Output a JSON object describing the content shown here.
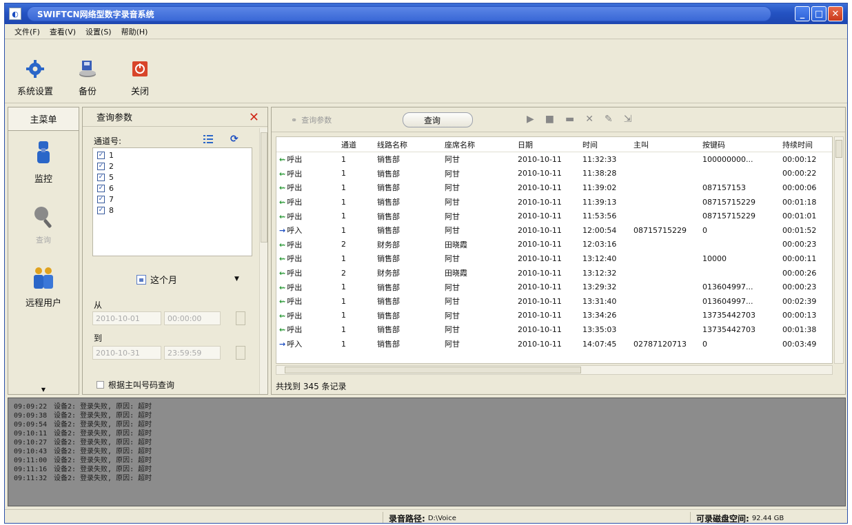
{
  "window": {
    "title": "SWIFTCN网络型数字录音系统"
  },
  "menu": [
    "文件(F)",
    "查看(V)",
    "设置(S)",
    "帮助(H)"
  ],
  "toolbar": [
    {
      "label": "系统设置",
      "icon": "gear-icon"
    },
    {
      "label": "备份",
      "icon": "backup-icon"
    },
    {
      "label": "关闭",
      "icon": "power-icon"
    }
  ],
  "sidebar": {
    "title": "主菜单",
    "items": [
      {
        "label": "监控",
        "icon": "monitor-icon",
        "dim": false
      },
      {
        "label": "查询",
        "icon": "magnifier-icon",
        "dim": true
      },
      {
        "label": "远程用户",
        "icon": "users-icon",
        "dim": false
      }
    ]
  },
  "query_params": {
    "title": "查询参数",
    "channel_label": "通道号:",
    "channels": [
      {
        "id": "1",
        "checked": true
      },
      {
        "id": "2",
        "checked": true
      },
      {
        "id": "5",
        "checked": true
      },
      {
        "id": "6",
        "checked": true
      },
      {
        "id": "7",
        "checked": true
      },
      {
        "id": "8",
        "checked": true
      }
    ],
    "period": "这个月",
    "from_label": "从",
    "from_date": "2010-10-01",
    "from_time": "00:00:00",
    "to_label": "到",
    "to_date": "2010-10-31",
    "to_time": "23:59:59",
    "caller_query": "根据主叫号码查询"
  },
  "records": {
    "query_params_button": "查询参数",
    "search_button": "查询",
    "columns": [
      "",
      "通道",
      "线路名称",
      "座席名称",
      "日期",
      "时间",
      "主叫",
      "按键码",
      "持续时间"
    ],
    "rows": [
      {
        "dir": "out",
        "dir_label": "呼出",
        "ch": "1",
        "line": "销售部",
        "seat": "阿甘",
        "date": "2010-10-11",
        "time": "11:32:33",
        "caller": "",
        "dtmf": "100000000...",
        "dur": "00:00:12"
      },
      {
        "dir": "out",
        "dir_label": "呼出",
        "ch": "1",
        "line": "销售部",
        "seat": "阿甘",
        "date": "2010-10-11",
        "time": "11:38:28",
        "caller": "",
        "dtmf": "",
        "dur": "00:00:22"
      },
      {
        "dir": "out",
        "dir_label": "呼出",
        "ch": "1",
        "line": "销售部",
        "seat": "阿甘",
        "date": "2010-10-11",
        "time": "11:39:02",
        "caller": "",
        "dtmf": "087157153",
        "dur": "00:00:06"
      },
      {
        "dir": "out",
        "dir_label": "呼出",
        "ch": "1",
        "line": "销售部",
        "seat": "阿甘",
        "date": "2010-10-11",
        "time": "11:39:13",
        "caller": "",
        "dtmf": "08715715229",
        "dur": "00:01:18"
      },
      {
        "dir": "out",
        "dir_label": "呼出",
        "ch": "1",
        "line": "销售部",
        "seat": "阿甘",
        "date": "2010-10-11",
        "time": "11:53:56",
        "caller": "",
        "dtmf": "08715715229",
        "dur": "00:01:01"
      },
      {
        "dir": "in",
        "dir_label": "呼入",
        "ch": "1",
        "line": "销售部",
        "seat": "阿甘",
        "date": "2010-10-11",
        "time": "12:00:54",
        "caller": "08715715229",
        "dtmf": "0",
        "dur": "00:01:52"
      },
      {
        "dir": "out",
        "dir_label": "呼出",
        "ch": "2",
        "line": "财务部",
        "seat": "田晓霞",
        "date": "2010-10-11",
        "time": "12:03:16",
        "caller": "",
        "dtmf": "",
        "dur": "00:00:23"
      },
      {
        "dir": "out",
        "dir_label": "呼出",
        "ch": "1",
        "line": "销售部",
        "seat": "阿甘",
        "date": "2010-10-11",
        "time": "13:12:40",
        "caller": "",
        "dtmf": "10000",
        "dur": "00:00:11"
      },
      {
        "dir": "out",
        "dir_label": "呼出",
        "ch": "2",
        "line": "财务部",
        "seat": "田晓霞",
        "date": "2010-10-11",
        "time": "13:12:32",
        "caller": "",
        "dtmf": "",
        "dur": "00:00:26"
      },
      {
        "dir": "out",
        "dir_label": "呼出",
        "ch": "1",
        "line": "销售部",
        "seat": "阿甘",
        "date": "2010-10-11",
        "time": "13:29:32",
        "caller": "",
        "dtmf": "013604997...",
        "dur": "00:00:23"
      },
      {
        "dir": "out",
        "dir_label": "呼出",
        "ch": "1",
        "line": "销售部",
        "seat": "阿甘",
        "date": "2010-10-11",
        "time": "13:31:40",
        "caller": "",
        "dtmf": "013604997...",
        "dur": "00:02:39"
      },
      {
        "dir": "out",
        "dir_label": "呼出",
        "ch": "1",
        "line": "销售部",
        "seat": "阿甘",
        "date": "2010-10-11",
        "time": "13:34:26",
        "caller": "",
        "dtmf": "13735442703",
        "dur": "00:00:13"
      },
      {
        "dir": "out",
        "dir_label": "呼出",
        "ch": "1",
        "line": "销售部",
        "seat": "阿甘",
        "date": "2010-10-11",
        "time": "13:35:03",
        "caller": "",
        "dtmf": "13735442703",
        "dur": "00:01:38"
      },
      {
        "dir": "in",
        "dir_label": "呼入",
        "ch": "1",
        "line": "销售部",
        "seat": "阿甘",
        "date": "2010-10-11",
        "time": "14:07:45",
        "caller": "02787120713",
        "dtmf": "0",
        "dur": "00:03:49"
      }
    ],
    "footer": "共找到 345 条记录"
  },
  "log": [
    {
      "time": "09:09:22",
      "msg": "设备2: 登录失败, 原因: 超时"
    },
    {
      "time": "09:09:38",
      "msg": "设备2: 登录失败, 原因: 超时"
    },
    {
      "time": "09:09:54",
      "msg": "设备2: 登录失败, 原因: 超时"
    },
    {
      "time": "09:10:11",
      "msg": "设备2: 登录失败, 原因: 超时"
    },
    {
      "time": "09:10:27",
      "msg": "设备2: 登录失败, 原因: 超时"
    },
    {
      "time": "09:10:43",
      "msg": "设备2: 登录失败, 原因: 超时"
    },
    {
      "time": "09:11:00",
      "msg": "设备2: 登录失败, 原因: 超时"
    },
    {
      "time": "09:11:16",
      "msg": "设备2: 登录失败, 原因: 超时"
    },
    {
      "time": "09:11:32",
      "msg": "设备2: 登录失败, 原因: 超时"
    }
  ],
  "status": {
    "path_label": "录音路径:",
    "path_value": "D:\\Voice",
    "disk_label": "可录磁盘空间:",
    "disk_value": "92.44 GB"
  },
  "colors": {
    "titlebar": "#2453c3",
    "out_arrow": "#2e9a3a",
    "in_arrow": "#1a4cc0",
    "close": "#d02818"
  }
}
